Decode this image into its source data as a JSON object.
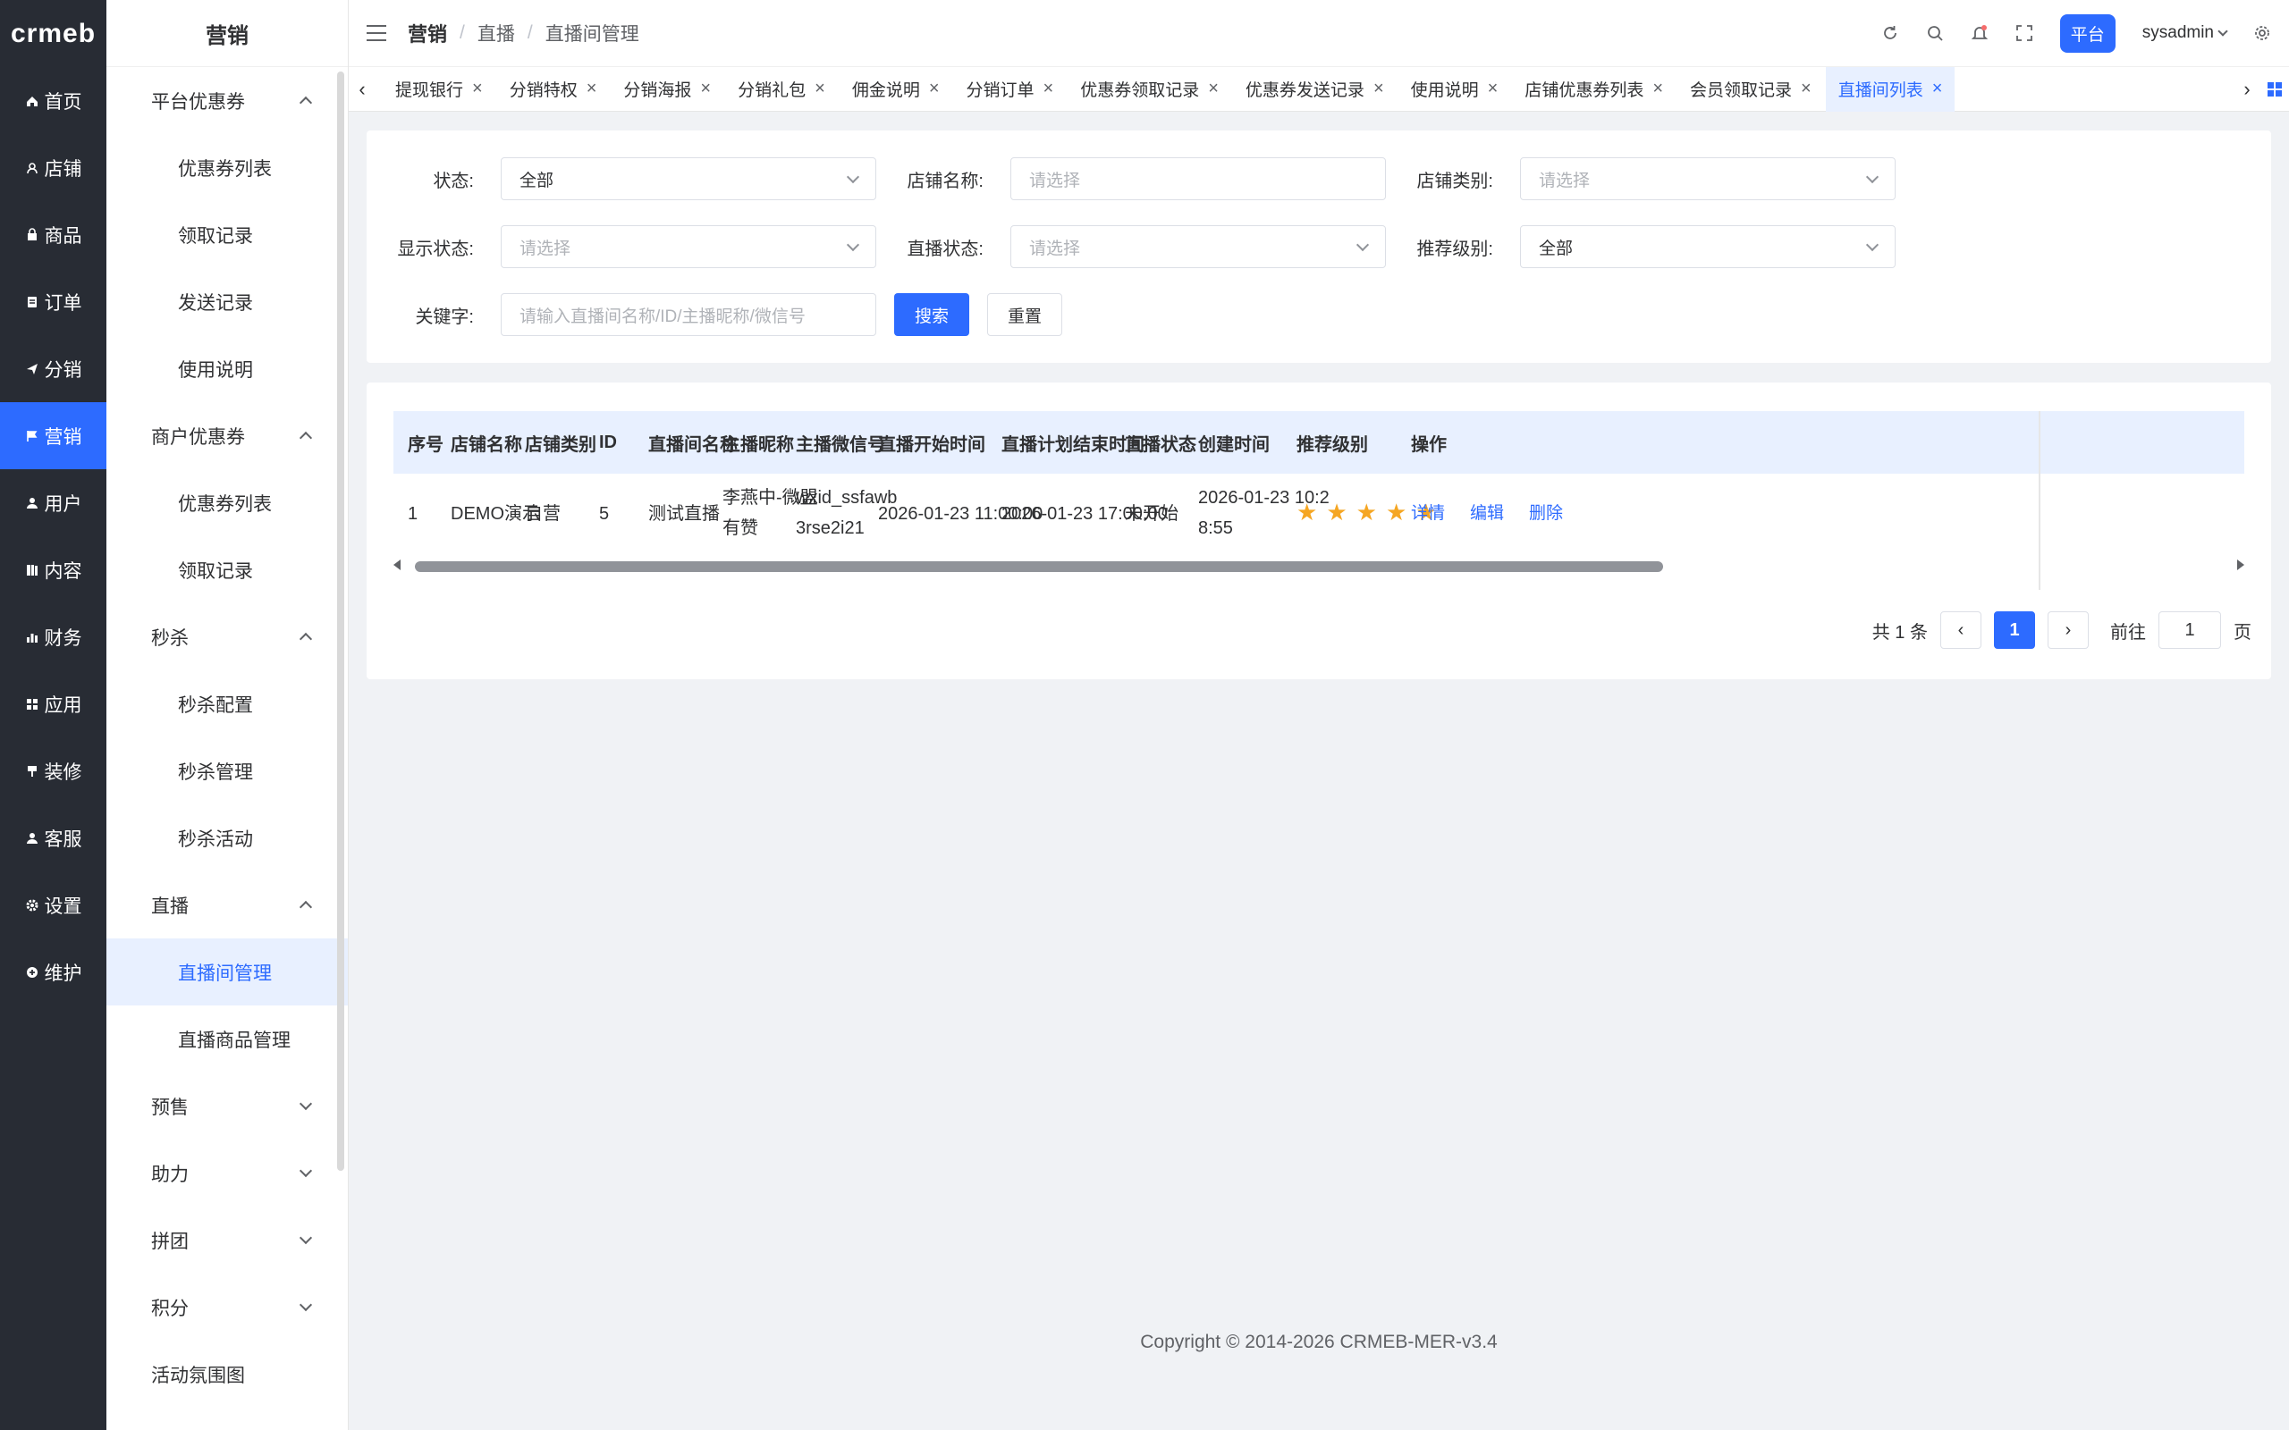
{
  "logo": "crmeb",
  "rail": [
    {
      "label": "首页",
      "icon": "home-icon"
    },
    {
      "label": "店铺",
      "icon": "store-icon"
    },
    {
      "label": "商品",
      "icon": "goods-icon"
    },
    {
      "label": "订单",
      "icon": "order-icon"
    },
    {
      "label": "分销",
      "icon": "send-icon"
    },
    {
      "label": "营销",
      "icon": "flag-icon"
    },
    {
      "label": "用户",
      "icon": "user-icon"
    },
    {
      "label": "内容",
      "icon": "content-icon"
    },
    {
      "label": "财务",
      "icon": "finance-icon"
    },
    {
      "label": "应用",
      "icon": "app-icon"
    },
    {
      "label": "装修",
      "icon": "brush-icon"
    },
    {
      "label": "客服",
      "icon": "service-icon"
    },
    {
      "label": "设置",
      "icon": "gear-icon"
    },
    {
      "label": "维护",
      "icon": "maintain-icon"
    }
  ],
  "submenu": {
    "title": "营销",
    "groups": [
      {
        "label": "平台优惠券",
        "items": [
          "优惠券列表",
          "领取记录",
          "发送记录",
          "使用说明"
        ]
      },
      {
        "label": "商户优惠券",
        "items": [
          "优惠券列表",
          "领取记录"
        ]
      },
      {
        "label": "秒杀",
        "items": [
          "秒杀配置",
          "秒杀管理",
          "秒杀活动"
        ]
      },
      {
        "label": "直播",
        "items": [
          "直播间管理",
          "直播商品管理"
        ]
      },
      {
        "label": "预售"
      },
      {
        "label": "助力"
      },
      {
        "label": "拼团"
      },
      {
        "label": "积分"
      },
      {
        "label": "活动氛围图"
      }
    ]
  },
  "header": {
    "breadcrumb": [
      "营销",
      "直播",
      "直播间管理"
    ],
    "platform": "平台",
    "username": "sysadmin"
  },
  "tabs": [
    "提现银行",
    "分销特权",
    "分销海报",
    "分销礼包",
    "佣金说明",
    "分销订单",
    "优惠券领取记录",
    "优惠券发送记录",
    "使用说明",
    "店铺优惠券列表",
    "会员领取记录",
    "直播间列表"
  ],
  "filters": {
    "status_label": "状态:",
    "status_value": "全部",
    "store_name_label": "店铺名称:",
    "store_name_placeholder": "请选择",
    "store_type_label": "店铺类别:",
    "store_type_placeholder": "请选择",
    "display_status_label": "显示状态:",
    "display_status_placeholder": "请选择",
    "live_status_label": "直播状态:",
    "live_status_placeholder": "请选择",
    "rec_level_label": "推荐级别:",
    "rec_level_value": "全部",
    "keyword_label": "关键字:",
    "keyword_placeholder": "请输入直播间名称/ID/主播昵称/微信号",
    "search": "搜索",
    "reset": "重置"
  },
  "table": {
    "columns": [
      "序号",
      "店铺名称",
      "店铺类别",
      "ID",
      "直播间名称",
      "主播昵称",
      "主播微信号",
      "直播开始时间",
      "直播计划结束时间",
      "直播状态",
      "创建时间",
      "推荐级别",
      "操作"
    ],
    "rows": [
      {
        "index": "1",
        "store_name": "DEMO演示",
        "store_type": "自营",
        "id": "5",
        "room_name": "测试直播",
        "anchor_line1": "李燕中-微盟",
        "anchor_line2": "有赞",
        "wechat_line1": "wxid_ssfawb",
        "wechat_line2": "3rse2i21",
        "start_time": "2026-01-23 11:00:00",
        "end_time": "2026-01-23 17:00:00",
        "live_status": "未开始",
        "created_line1": "2026-01-23 10:2",
        "created_line2": "8:55",
        "rating": 5,
        "actions": [
          "详情",
          "编辑",
          "删除"
        ]
      }
    ]
  },
  "pager": {
    "total": "共 1 条",
    "current": "1",
    "goto_label": "前往",
    "goto_value": "1",
    "page_suffix": "页"
  },
  "footer": "Copyright © 2014-2026 CRMEB-MER-v3.4",
  "colors": {
    "primary": "#2d6bff",
    "rail_bg": "#282c34",
    "star": "#f5a623"
  }
}
